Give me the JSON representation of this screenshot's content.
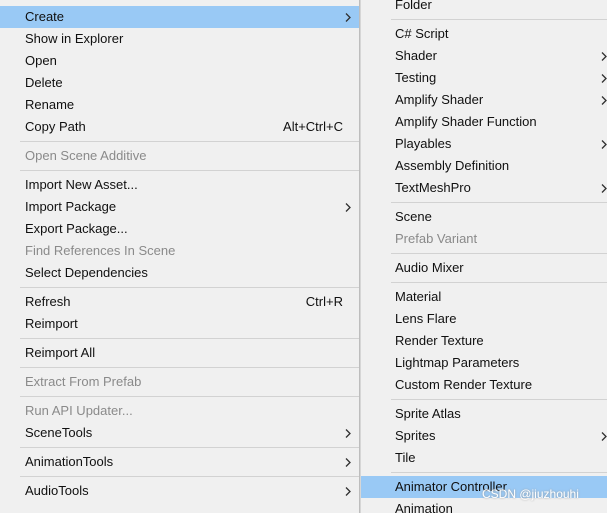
{
  "main_menu": {
    "create": "Create",
    "show_in_explorer": "Show in Explorer",
    "open": "Open",
    "delete": "Delete",
    "rename": "Rename",
    "copy_path": "Copy Path",
    "copy_path_shortcut": "Alt+Ctrl+C",
    "open_scene_additive": "Open Scene Additive",
    "import_new_asset": "Import New Asset...",
    "import_package": "Import Package",
    "export_package": "Export Package...",
    "find_references": "Find References In Scene",
    "select_dependencies": "Select Dependencies",
    "refresh": "Refresh",
    "refresh_shortcut": "Ctrl+R",
    "reimport": "Reimport",
    "reimport_all": "Reimport All",
    "extract_from_prefab": "Extract From Prefab",
    "run_api_updater": "Run API Updater...",
    "scene_tools": "SceneTools",
    "animation_tools": "AnimationTools",
    "audio_tools": "AudioTools"
  },
  "create_submenu": {
    "folder": "Folder",
    "csharp_script": "C# Script",
    "shader": "Shader",
    "testing": "Testing",
    "amplify_shader": "Amplify Shader",
    "amplify_shader_function": "Amplify Shader Function",
    "playables": "Playables",
    "assembly_definition": "Assembly Definition",
    "textmeshpro": "TextMeshPro",
    "scene": "Scene",
    "prefab_variant": "Prefab Variant",
    "audio_mixer": "Audio Mixer",
    "material": "Material",
    "lens_flare": "Lens Flare",
    "render_texture": "Render Texture",
    "lightmap_parameters": "Lightmap Parameters",
    "custom_render_texture": "Custom Render Texture",
    "sprite_atlas": "Sprite Atlas",
    "sprites": "Sprites",
    "tile": "Tile",
    "animator_controller": "Animator Controller",
    "animation": "Animation"
  },
  "watermark": "CSDN @jiuzhouhi",
  "colors": {
    "menu_background": "#f0f0f0",
    "highlight": "#99c9f5",
    "disabled_text": "#8a8a8a",
    "separator": "#d2d2d2"
  },
  "icons": {
    "submenu_arrow": "chevron-right-icon"
  }
}
